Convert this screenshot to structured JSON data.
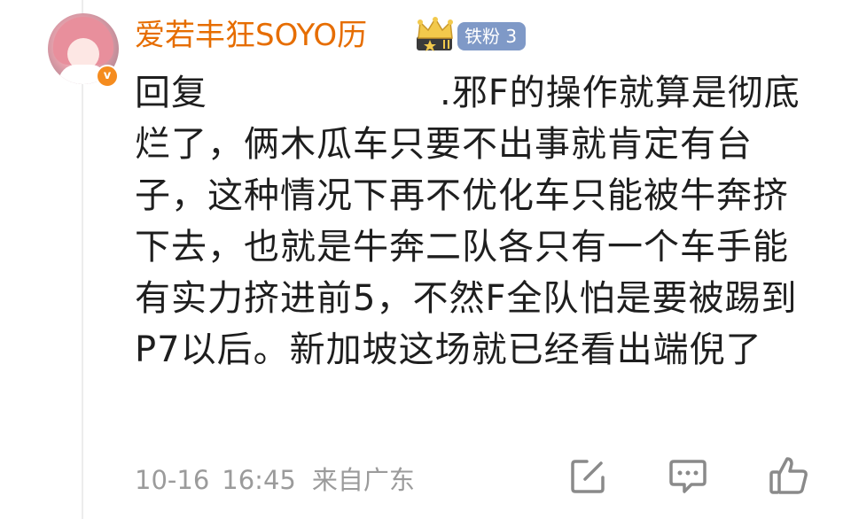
{
  "comment": {
    "author": {
      "name": "爱若丰狂SOYO历",
      "avatar_icon": "avatar",
      "verified_icon": "verified-v-icon",
      "verified_mark": "v",
      "crown_badge_icon": "crown-badge-icon",
      "fan_badge": "铁粉 3"
    },
    "reply_prefix": "回复",
    "body_after_mention": ".邪F的操作就算是彻底烂了，俩木瓜车只要不出事就肯定有台子，这种情况下再不优化车只能被牛奔挤下去，也就是牛奔二队各只有一个车手能有实力挤进前5，不然F全队怕是要被踢到P7以后。新加坡这场就已经看出端倪了",
    "date": "10-16",
    "time": "16:45",
    "source": "来自广东"
  },
  "actions": {
    "edit_icon": "edit-icon",
    "comment_icon": "comment-icon",
    "like_icon": "thumbs-up-icon"
  },
  "colors": {
    "username": "#e66d00",
    "body_text": "#1e1e1e",
    "meta_text": "#9b9b9b",
    "fan_badge_bg": "#7f99c7",
    "verified_bg": "#f58c1f",
    "icon_stroke": "#8a8a8a"
  }
}
